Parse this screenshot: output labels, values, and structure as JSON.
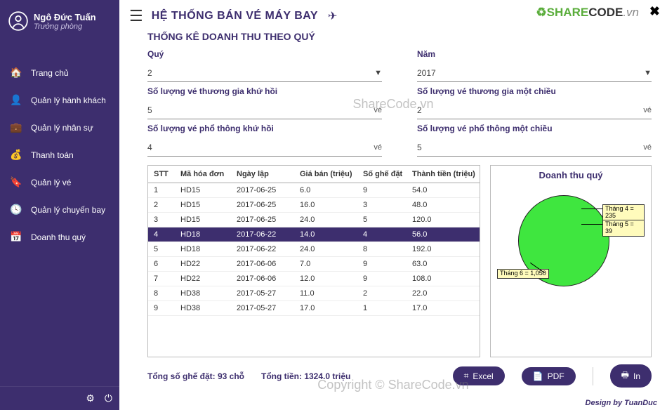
{
  "profile": {
    "name": "Ngô Đức Tuấn",
    "role": "Trưởng phòng"
  },
  "sidebar": {
    "items": [
      {
        "icon": "home-icon",
        "glyph": "🏠",
        "label": "Trang chủ"
      },
      {
        "icon": "user-icon",
        "glyph": "👤",
        "label": "Quản lý hành khách"
      },
      {
        "icon": "briefcase-icon",
        "glyph": "💼",
        "label": "Quản lý nhân sự"
      },
      {
        "icon": "money-icon",
        "glyph": "💰",
        "label": "Thanh toán"
      },
      {
        "icon": "ticket-icon",
        "glyph": "🔖",
        "label": "Quản lý vé"
      },
      {
        "icon": "clock-icon",
        "glyph": "🕓",
        "label": "Quản lý chuyến bay"
      },
      {
        "icon": "calendar-icon",
        "glyph": "📅",
        "label": "Doanh thu quý"
      }
    ]
  },
  "header": {
    "title": "HỆ THỐNG BÁN VÉ MÁY BAY",
    "logo_brand": "SHARE",
    "logo_code": "CODE",
    "logo_suffix": ".vn"
  },
  "page": {
    "title": "THỐNG KÊ DOANH THU THEO QUÝ"
  },
  "filters": {
    "quarter_label": "Quý",
    "quarter_value": "2",
    "year_label": "Năm",
    "year_value": "2017",
    "biz_round_label": "Số lượng vé thương gia khứ hồi",
    "biz_round_value": "5",
    "biz_one_label": "Số lượng vé thương gia một chiều",
    "biz_one_value": "2",
    "econ_round_label": "Số lượng vé phổ thông khứ hồi",
    "econ_round_value": "4",
    "econ_one_label": "Số lượng vé phổ thông một chiều",
    "econ_one_value": "5",
    "unit": "vé"
  },
  "table": {
    "headers": [
      "STT",
      "Mã hóa đơn",
      "Ngày lập",
      "Giá bán (triệu)",
      "Số ghế đặt",
      "Thành tiền (triệu)"
    ],
    "rows": [
      [
        "1",
        "HD15",
        "2017-06-25",
        "6.0",
        "9",
        "54.0"
      ],
      [
        "2",
        "HD15",
        "2017-06-25",
        "16.0",
        "3",
        "48.0"
      ],
      [
        "3",
        "HD15",
        "2017-06-25",
        "24.0",
        "5",
        "120.0"
      ],
      [
        "4",
        "HD18",
        "2017-06-22",
        "14.0",
        "4",
        "56.0"
      ],
      [
        "5",
        "HD18",
        "2017-06-22",
        "24.0",
        "8",
        "192.0"
      ],
      [
        "6",
        "HD22",
        "2017-06-06",
        "7.0",
        "9",
        "63.0"
      ],
      [
        "7",
        "HD22",
        "2017-06-06",
        "12.0",
        "9",
        "108.0"
      ],
      [
        "8",
        "HD38",
        "2017-05-27",
        "11.0",
        "2",
        "22.0"
      ],
      [
        "9",
        "HD38",
        "2017-05-27",
        "17.0",
        "1",
        "17.0"
      ]
    ],
    "selected_index": 3
  },
  "summary": {
    "seats_label": "Tổng số ghế đặt: 93 chỗ",
    "total_label": "Tổng tiền: 1324.0 triệu"
  },
  "actions": {
    "excel": "Excel",
    "pdf": "PDF",
    "print": "In"
  },
  "chart_title": "Doanh thu quý",
  "chart_data": {
    "type": "pie",
    "title": "Doanh thu quý",
    "series": [
      {
        "name": "Tháng 4",
        "value": 235,
        "color": "#ff2d2d"
      },
      {
        "name": "Tháng 5",
        "value": 39,
        "color": "#1f3fff"
      },
      {
        "name": "Tháng 6",
        "value": 1050,
        "color": "#3fe63f"
      }
    ],
    "labels": [
      "Tháng 4 = 235",
      "Tháng 5 = 39",
      "Tháng 6 = 1,050"
    ]
  },
  "footer": {
    "credit": "Design by TuanDuc"
  },
  "watermark": {
    "line1": "ShareCode.vn",
    "line2": "Copyright © ShareCode.vn"
  }
}
